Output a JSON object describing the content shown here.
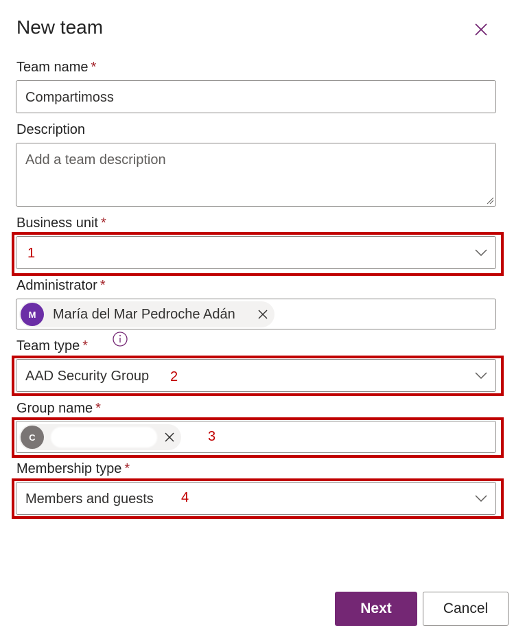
{
  "dialog": {
    "title": "New team",
    "close_icon": "close-icon"
  },
  "fields": {
    "team_name": {
      "label": "Team name",
      "required": "*",
      "value": "Compartimoss"
    },
    "description": {
      "label": "Description",
      "placeholder": "Add a team description"
    },
    "business_unit": {
      "label": "Business unit",
      "required": "*",
      "marker": "1",
      "value": ""
    },
    "administrator": {
      "label": "Administrator",
      "required": "*",
      "avatar_initial": "M",
      "value": "María del Mar Pedroche Adán",
      "avatar_color": "#6b2ea6"
    },
    "team_type": {
      "label": "Team type",
      "required": "*",
      "info_icon": "info-icon",
      "value": "AAD Security Group",
      "marker": "2"
    },
    "group_name": {
      "label": "Group name",
      "required": "*",
      "avatar_initial": "C",
      "marker": "3",
      "avatar_color": "#7a7574"
    },
    "membership_type": {
      "label": "Membership type",
      "required": "*",
      "value": "Members and guests",
      "marker": "4"
    }
  },
  "buttons": {
    "next": "Next",
    "cancel": "Cancel"
  },
  "colors": {
    "brand": "#742774",
    "annotation": "#c00000",
    "required": "#a4262c"
  }
}
